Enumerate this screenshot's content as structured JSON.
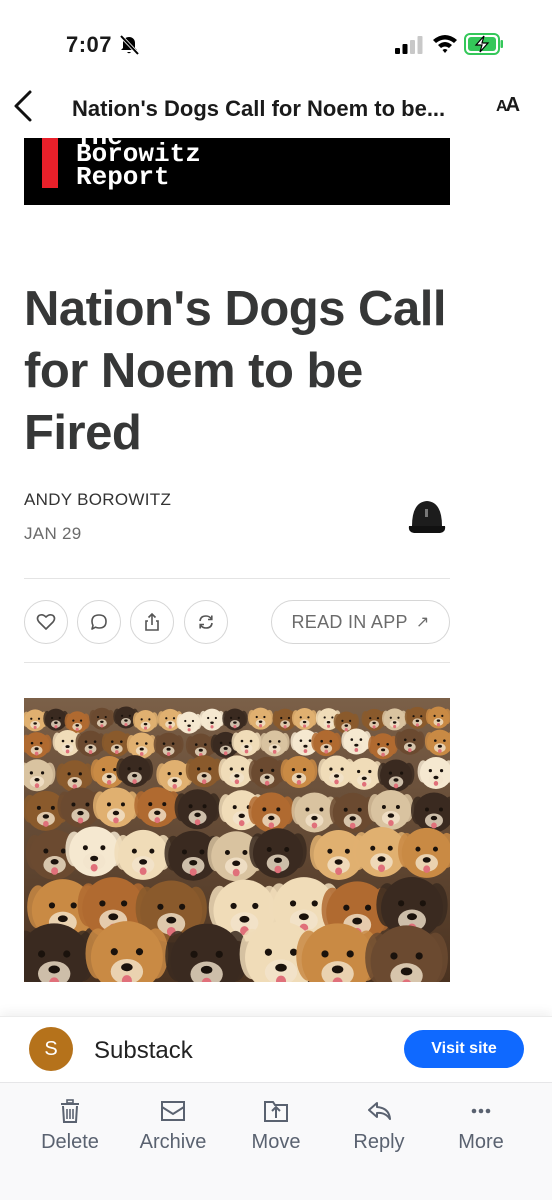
{
  "status_bar": {
    "time": "7:07"
  },
  "nav": {
    "title": "Nation's Dogs Call for Noem to be...",
    "text_size_label_big": "A",
    "text_size_label_small": "A"
  },
  "masthead": {
    "line_top": "The",
    "line1": "Borowitz",
    "line2": "Report"
  },
  "article": {
    "headline": "Nation's Dogs Call for Noem to be Fired",
    "author": "ANDY BOROWITZ",
    "date": "JAN 29",
    "read_in_app": "READ IN APP",
    "read_in_app_arrow": "↗"
  },
  "sender": {
    "initial": "S",
    "name": "Substack",
    "visit_button": "Visit site"
  },
  "toolbar": {
    "delete": "Delete",
    "archive": "Archive",
    "move": "Move",
    "reply": "Reply",
    "more": "More"
  },
  "colors": {
    "accent_blue": "#0f69ff",
    "sender_avatar": "#b5721b",
    "masthead_red": "#e8202a",
    "battery_green": "#34c759"
  }
}
